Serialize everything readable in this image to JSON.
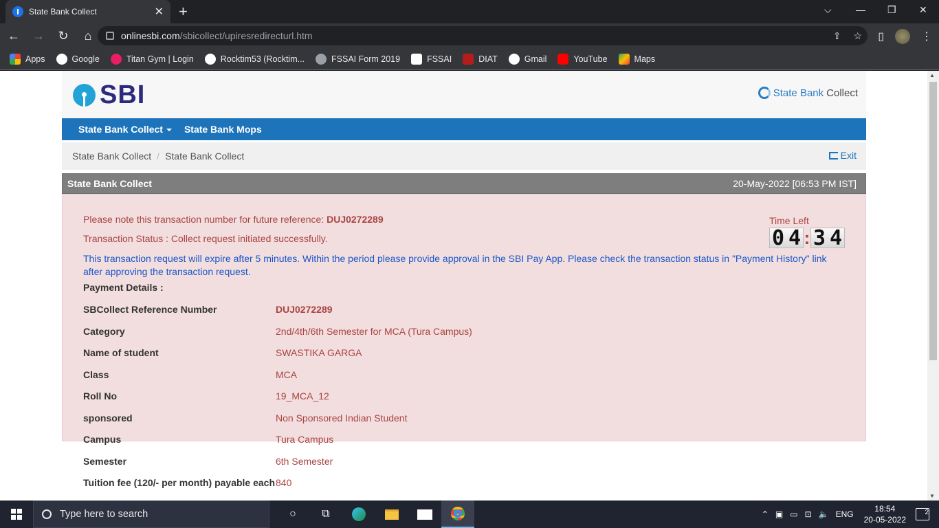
{
  "browser": {
    "tab_title": "State Bank Collect",
    "url_host": "onlinesbi.com",
    "url_path": "/sbicollect/upiresredirecturl.htm",
    "bookmarks": [
      {
        "label": "Apps",
        "icon": "apps-grid-icon",
        "color": "#ea4335"
      },
      {
        "label": "Google",
        "icon": "google-icon",
        "color": "#ffffff"
      },
      {
        "label": "Titan Gym | Login",
        "icon": "titan-gym-icon",
        "color": "#e91e63"
      },
      {
        "label": "Rocktim53 (Rocktim...",
        "icon": "github-icon",
        "color": "#ffffff"
      },
      {
        "label": "FSSAI Form 2019",
        "icon": "globe-icon",
        "color": "#9aa0a6"
      },
      {
        "label": "FSSAI",
        "icon": "fssai-icon",
        "color": "#ffffff"
      },
      {
        "label": "DIAT",
        "icon": "diat-icon",
        "color": "#b71c1c"
      },
      {
        "label": "Gmail",
        "icon": "google-icon",
        "color": "#ffffff"
      },
      {
        "label": "YouTube",
        "icon": "youtube-icon",
        "color": "#ff0000"
      },
      {
        "label": "Maps",
        "icon": "maps-icon",
        "color": "#34a853"
      }
    ]
  },
  "site": {
    "logo_text": "SBI",
    "brand_prefix": "State Bank",
    "brand_suffix": "Collect",
    "nav": {
      "item1": "State Bank Collect",
      "item2": "State Bank Mops"
    },
    "breadcrumb": [
      "State Bank Collect",
      "State Bank Collect"
    ],
    "exit_label": "Exit"
  },
  "panel": {
    "title": "State Bank Collect",
    "datetime": "20-May-2022 [06:53 PM IST]",
    "note_prefix": "Please note this transaction number for future reference:",
    "txn_number": "DUJ0272289",
    "status": "Transaction Status : Collect request initiated successfully.",
    "expiry_note": "This transaction request will expire after 5 minutes. Within the period please provide approval in the SBI Pay App. Please check the transaction status in \"Payment History\" link after approving the transaction request.",
    "timer": {
      "label": "Time Left",
      "minutes": [
        "0",
        "4"
      ],
      "seconds": [
        "3",
        "4"
      ],
      "separator": ":"
    },
    "payment_details_title": "Payment Details :",
    "details": [
      {
        "key": "SBCollect Reference Number",
        "value": "DUJ0272289"
      },
      {
        "key": "Category",
        "value": "2nd/4th/6th Semester for MCA (Tura Campus)"
      },
      {
        "key": "Name of student",
        "value": "SWASTIKA GARGA"
      },
      {
        "key": "Class",
        "value": "MCA"
      },
      {
        "key": "Roll No",
        "value": "19_MCA_12"
      },
      {
        "key": "sponsored",
        "value": "Non Sponsored Indian Student"
      },
      {
        "key": "Campus",
        "value": "Tura Campus"
      },
      {
        "key": "Semester",
        "value": "6th Semester"
      },
      {
        "key": "Tuition fee (120/- per month) payable each",
        "value": "840"
      }
    ]
  },
  "taskbar": {
    "search_placeholder": "Type here to search",
    "language": "ENG",
    "time": "18:54",
    "date": "20-05-2022",
    "notifications": "2"
  }
}
